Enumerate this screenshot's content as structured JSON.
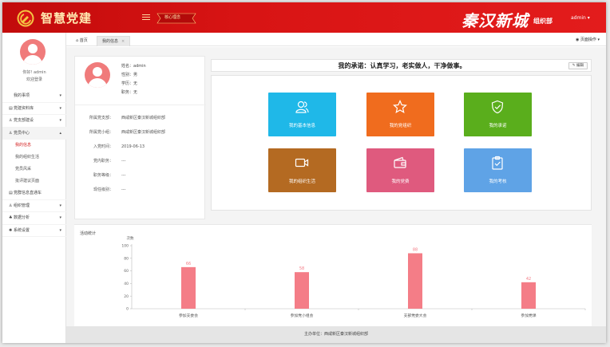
{
  "header": {
    "logo_text": "智慧党建",
    "banner_text": "核心理念",
    "calligraphy": "秦汉新城",
    "calligraphy_sub": "组织部",
    "user_menu": "admin ▾",
    "brand_color": "#d81414"
  },
  "sidebar": {
    "user_line": "你好! admin",
    "welcome": "欢迎登录",
    "items": [
      {
        "label": "我的事项",
        "icon": "",
        "caret": "▾"
      },
      {
        "label": "党建资料库",
        "icon": "▤",
        "caret": "▾"
      },
      {
        "label": "党支部建设",
        "icon": "♙",
        "caret": "▾"
      },
      {
        "label": "党员中心",
        "icon": "♙",
        "caret": "▴"
      }
    ],
    "sub_items": [
      {
        "label": "我的信息"
      },
      {
        "label": "我的组织生活"
      },
      {
        "label": "党员风采"
      },
      {
        "label": "批评建议页面"
      }
    ],
    "items_after": [
      {
        "label": "党群信息直通车",
        "icon": "▤",
        "caret": ""
      },
      {
        "label": "组织管理",
        "icon": "♙",
        "caret": "▾"
      },
      {
        "label": "数据分析",
        "icon": "♣",
        "caret": "▾"
      },
      {
        "label": "系统设置",
        "icon": "✺",
        "caret": "▾"
      }
    ]
  },
  "tabs": {
    "home": "首页",
    "active": "我的信息",
    "close": "×",
    "page_ops": "页面操作 ▾"
  },
  "profile": {
    "name": "姓名：admin",
    "gender": "性别：男",
    "education": "学历：无",
    "position": "职务：无",
    "details": [
      {
        "label": "所属党支部：",
        "value": "西咸新区秦汉新城组织部"
      },
      {
        "label": "所属党小组：",
        "value": "西咸新区秦汉新城组织部"
      },
      {
        "label": "入党时间：",
        "value": "2019-06-13"
      },
      {
        "label": "党内职务：",
        "value": "---"
      },
      {
        "label": "职务等级：",
        "value": "---"
      },
      {
        "label": "现任级别：",
        "value": "---"
      }
    ]
  },
  "promise": {
    "text": "我的承诺：认真学习，老实做人，干净做事。",
    "edit": "✎ 编辑"
  },
  "tiles": [
    {
      "label": "我的基本信息",
      "icon": "users-icon",
      "color": "#1fb8e8"
    },
    {
      "label": "我的党组织",
      "icon": "star-icon",
      "color": "#f06c1e"
    },
    {
      "label": "我的承诺",
      "icon": "shield-check-icon",
      "color": "#5aae1c"
    },
    {
      "label": "我的组织生活",
      "icon": "video-icon",
      "color": "#b46a22"
    },
    {
      "label": "我的党费",
      "icon": "wallet-icon",
      "color": "#df5a7e"
    },
    {
      "label": "我的考核",
      "icon": "clipboard-check-icon",
      "color": "#5fa3e6"
    }
  ],
  "stats": {
    "title": "活动统计"
  },
  "chart_data": {
    "type": "bar",
    "title": "",
    "xlabel": "",
    "ylabel": "次数",
    "categories": [
      "参加支委会",
      "参加党小组会",
      "支部党委大会",
      "参加党课"
    ],
    "values": [
      66,
      58,
      88,
      42
    ],
    "yticks": [
      0,
      20,
      40,
      60,
      80,
      100
    ],
    "ylim": [
      0,
      100
    ],
    "color": "#f47d87",
    "grid": false
  },
  "footer": {
    "text": "主办单位：西咸新区秦汉新城组织部"
  }
}
